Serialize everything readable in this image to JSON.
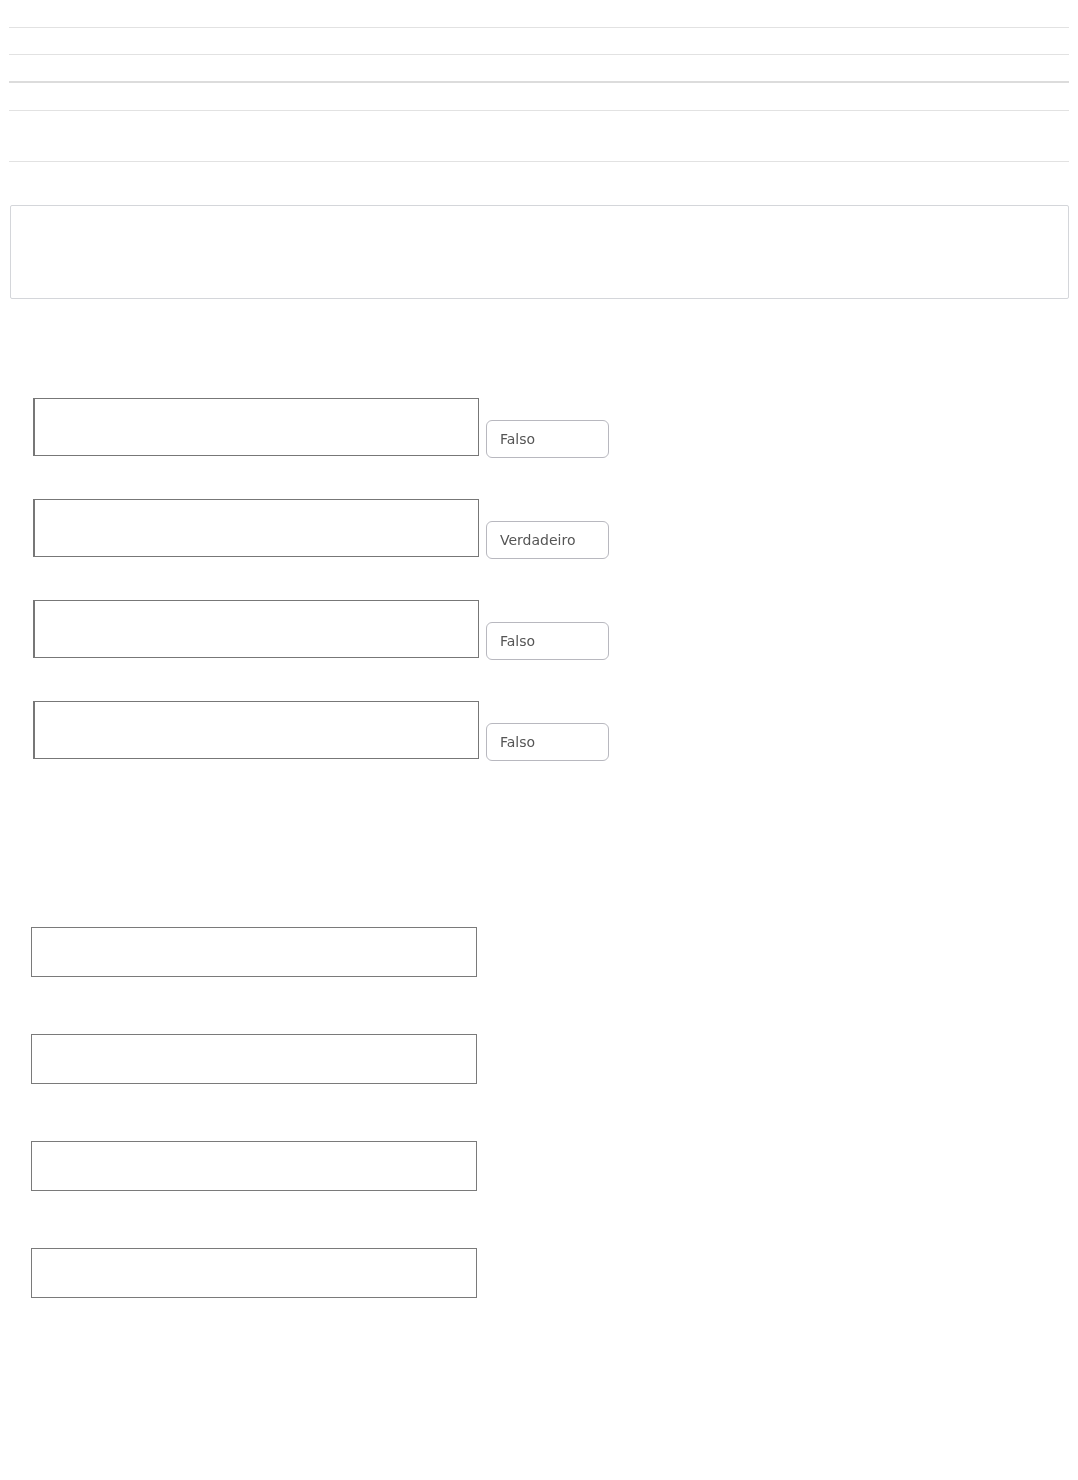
{
  "statements": [
    {
      "answer": "Falso"
    },
    {
      "answer": "Verdadeiro"
    },
    {
      "answer": "Falso"
    },
    {
      "answer": "Falso"
    }
  ]
}
